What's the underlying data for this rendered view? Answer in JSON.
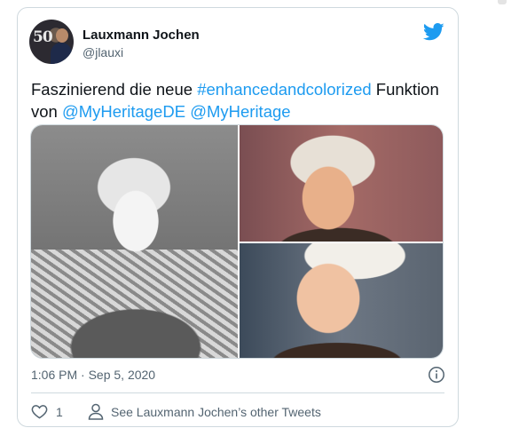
{
  "tweet": {
    "author_name": "Lauxmann Jochen",
    "author_handle": "@jlauxi",
    "avatar_badge": "50",
    "text_before": "Faszinierend die neue ",
    "hashtag": "#enhancedandcolorized",
    "text_middle": " Funktion von ",
    "mention_1": "@MyHeritageDE",
    "text_space": " ",
    "mention_2": "@MyHeritage",
    "timestamp": "1:06 PM · Sep 5, 2020",
    "like_count": "1",
    "other_tweets_label": "See Lauxmann Jochen’s other Tweets"
  },
  "icons": {
    "brand": "twitter-bird-icon",
    "info": "info-icon",
    "like": "heart-icon",
    "profile": "person-icon"
  },
  "colors": {
    "link": "#1d9bf0",
    "brand": "#1d9bf0",
    "secondary_text": "#536471",
    "border": "#cfd9de"
  }
}
